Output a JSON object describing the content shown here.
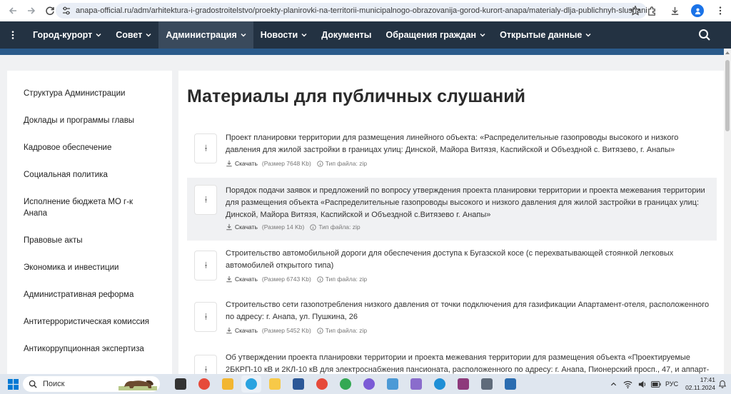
{
  "browser": {
    "url": "anapa-official.ru/adm/arhitektura-i-gradostroitelstvo/proekty-planirovki-na-territorii-municipalnogo-obrazovanija-gorod-kurort-anapa/materialy-dlja-publichnyh-slushanij/"
  },
  "nav": {
    "items": [
      {
        "label": "Город-курорт",
        "dropdown": true,
        "active": false
      },
      {
        "label": "Совет",
        "dropdown": true,
        "active": false
      },
      {
        "label": "Администрация",
        "dropdown": true,
        "active": true
      },
      {
        "label": "Новости",
        "dropdown": true,
        "active": false
      },
      {
        "label": "Документы",
        "dropdown": false,
        "active": false
      },
      {
        "label": "Обращения граждан",
        "dropdown": true,
        "active": false
      },
      {
        "label": "Открытые данные",
        "dropdown": true,
        "active": false
      }
    ]
  },
  "sidebar": {
    "items": [
      "Структура Администрации",
      "Доклады и программы главы",
      "Кадровое обеспечение",
      "Социальная политика",
      "Исполнение бюджета МО г-к Анапа",
      "Правовые акты",
      "Экономика и инвестиции",
      "Административная реформа",
      "Антитеррористическая комиссия",
      "Антикоррупционная экспертиза"
    ]
  },
  "main": {
    "title": "Материалы для публичных слушаний",
    "documents": [
      {
        "title": "Проект планировки территории для размещения линейного объекта: «Распределительные газопроводы высокого и низкого давления для жилой застройки в границах улиц: Динской, Майора Витязя, Каспийской и Объездной с. Витязево, г. Анапы»",
        "download": "Скачать",
        "size": "(Размер 7648 Kb)",
        "filetype": "Тип файла: zip",
        "highlighted": false
      },
      {
        "title": "Порядок подачи заявок и предложений по вопросу утверждения проекта планировки территории и проекта межевания территории для размещения объекта «Распределительные газопроводы высокого и низкого давления для жилой застройки в границах улиц: Динской, Майора Витязя, Каспийской и Объездной с.Витязево г. Анапы»",
        "download": "Скачать",
        "size": "(Размер 14 Kb)",
        "filetype": "Тип файла: zip",
        "highlighted": true
      },
      {
        "title": "Строительство автомобильной дороги для обеспечения доступа к Бугазской косе (с перехватывающей стоянкой легковых автомобилей открытого типа)",
        "download": "Скачать",
        "size": "(Размер 6743 Kb)",
        "filetype": "Тип файла: zip",
        "highlighted": false
      },
      {
        "title": "Строительство сети газопотребления низкого давления от точки подключения для газификации Апартамент-отеля, расположенного по адресу: г. Анапа, ул. Пушкина, 26",
        "download": "Скачать",
        "size": "(Размер 5452 Kb)",
        "filetype": "Тип файла: zip",
        "highlighted": false
      },
      {
        "title": "Об утверждении проекта планировки территории и проекта межевания территории для размещения объекта «Проектируемые 2БКРП-10 кВ и 2КЛ-10 кВ для электроснабжения пансионата, расположенного по адресу: г. Анапа, Пионерский просп., 47, и аппарт-",
        "download": "",
        "size": "",
        "filetype": "",
        "highlighted": false
      }
    ]
  },
  "taskbar": {
    "search_placeholder": "Поиск",
    "language": "РУС",
    "time": "17:41",
    "date": "02.11.2024",
    "apps": [
      {
        "icon": "task-view-icon",
        "color": "#333333"
      },
      {
        "icon": "chrome-icon",
        "color": "#e64a3a"
      },
      {
        "icon": "file-explorer-icon",
        "color": "#f2b632"
      },
      {
        "icon": "telegram-icon",
        "color": "#2aa3e0"
      },
      {
        "icon": "yandex-mail-icon",
        "color": "#f7c948"
      },
      {
        "icon": "word-icon",
        "color": "#2b5797"
      },
      {
        "icon": "chrome-icon-2",
        "color": "#e64a3a"
      },
      {
        "icon": "chrome-icon-3",
        "color": "#34a853"
      },
      {
        "icon": "yandex-browser-icon",
        "color": "#7b5bd6"
      },
      {
        "icon": "app-icon",
        "color": "#4c9ad6"
      },
      {
        "icon": "feather-icon",
        "color": "#8a6ccc"
      },
      {
        "icon": "edge-icon",
        "color": "#1f8fd6"
      },
      {
        "icon": "winrar-icon",
        "color": "#8e3a7c"
      },
      {
        "icon": "calculator-icon",
        "color": "#5f6b7a"
      },
      {
        "icon": "remote-desktop-icon",
        "color": "#2b6cb0"
      }
    ]
  }
}
